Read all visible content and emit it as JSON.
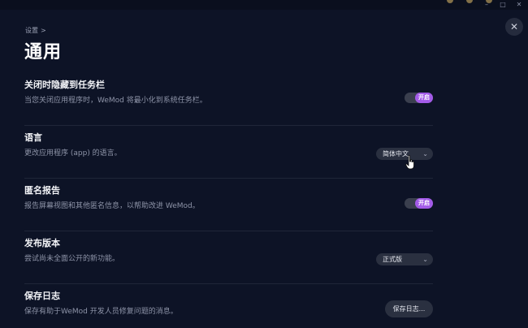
{
  "window": {
    "controls": [
      "–",
      "□",
      "✕"
    ]
  },
  "close_label": "✕",
  "breadcrumb": {
    "label": "设置",
    "chevron": ">"
  },
  "page_title": "通用",
  "settings": [
    {
      "title": "关闭时隐藏到任务栏",
      "description": "当您关闭应用程序时，WeMod 将最小化到系统任务栏。",
      "control": "toggle",
      "value": "开启"
    },
    {
      "title": "语言",
      "description": "更改应用程序 (app) 的语言。",
      "control": "select",
      "value": "简体中文"
    },
    {
      "title": "匿名报告",
      "description": "报告屏幕视图和其他匿名信息，以帮助改进 WeMod。",
      "control": "toggle",
      "value": "开启"
    },
    {
      "title": "发布版本",
      "description": "尝试尚未全面公开的新功能。",
      "control": "select",
      "value": "正式版"
    },
    {
      "title": "保存日志",
      "description": "保存有助于WeMod 开发人员修复问题的消息。",
      "control": "button",
      "value": "保存日志..."
    }
  ],
  "select_chevron": "⌄",
  "colors": {
    "background": "#0d1326",
    "accent": "#a35be8",
    "control_bg": "#2a3040"
  },
  "icons": {
    "close": "close-icon",
    "cursor": "hand-pointer-icon",
    "chevron": "chevron-down-icon"
  }
}
